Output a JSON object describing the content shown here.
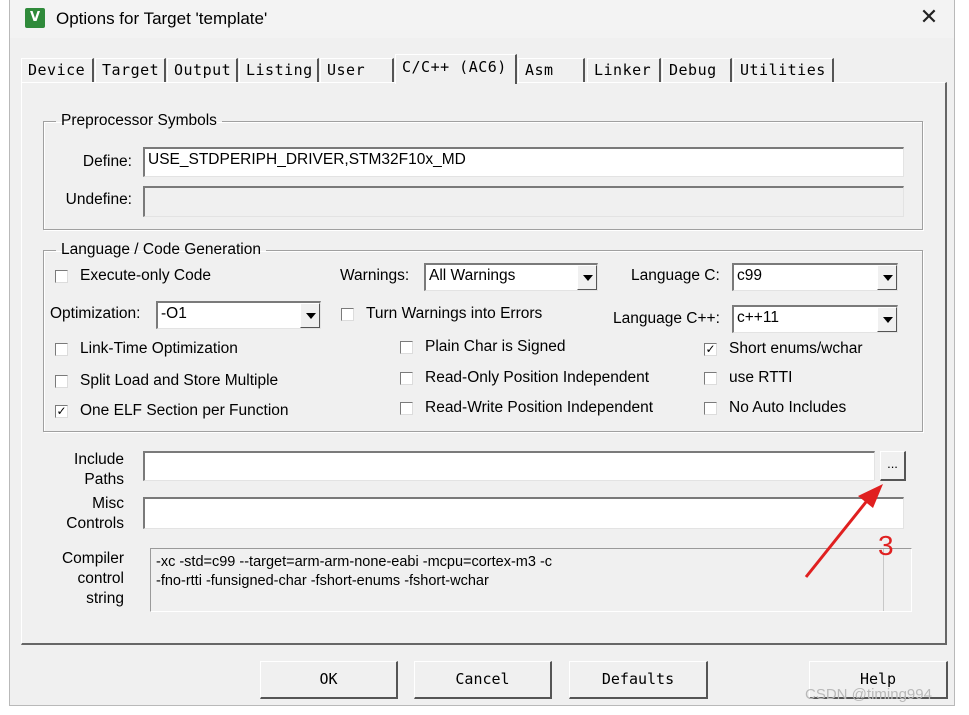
{
  "window": {
    "title": "Options for Target 'template'",
    "close_glyph": "✕"
  },
  "tabs": [
    {
      "label": "Device"
    },
    {
      "label": "Target"
    },
    {
      "label": "Output"
    },
    {
      "label": "Listing"
    },
    {
      "label": "User"
    },
    {
      "label": "C/C++ (AC6)",
      "active": true
    },
    {
      "label": "Asm"
    },
    {
      "label": "Linker"
    },
    {
      "label": "Debug"
    },
    {
      "label": "Utilities"
    }
  ],
  "preprocessor": {
    "title": "Preprocessor Symbols",
    "define_label": "Define:",
    "define_value": "USE_STDPERIPH_DRIVER,STM32F10x_MD",
    "undefine_label": "Undefine:",
    "undefine_value": ""
  },
  "language": {
    "title": "Language / Code Generation",
    "execute_only": {
      "label": "Execute-only Code",
      "checked": false
    },
    "warnings_label": "Warnings:",
    "warnings_value": "All Warnings",
    "language_c_label": "Language C:",
    "language_c_value": "c99",
    "optimization_label": "Optimization:",
    "optimization_value": "-O1",
    "warnings_errors": {
      "label": "Turn Warnings into Errors",
      "checked": false
    },
    "language_cpp_label": "Language C++:",
    "language_cpp_value": "c++11",
    "link_time": {
      "label": "Link-Time Optimization",
      "checked": false
    },
    "plain_char": {
      "label": "Plain Char is Signed",
      "checked": false
    },
    "short_enums": {
      "label": "Short enums/wchar",
      "checked": true
    },
    "split_load": {
      "label": "Split Load and Store Multiple",
      "checked": false
    },
    "ropi": {
      "label": "Read-Only Position Independent",
      "checked": false
    },
    "rtti": {
      "label": "use RTTI",
      "checked": false
    },
    "one_elf": {
      "label": "One ELF Section per Function",
      "checked": true
    },
    "rwpi": {
      "label": "Read-Write Position Independent",
      "checked": false
    },
    "no_auto_includes": {
      "label": "No Auto Includes",
      "checked": false
    },
    "check_mark": "✓"
  },
  "paths": {
    "include_label_1": "Include",
    "include_label_2": "Paths",
    "include_value": "",
    "browse_label": "...",
    "misc_label_1": "Misc",
    "misc_label_2": "Controls",
    "misc_value": "",
    "compiler_label_1": "Compiler",
    "compiler_label_2": "control",
    "compiler_label_3": "string",
    "compiler_line_1": "-xc -std=c99 --target=arm-arm-none-eabi -mcpu=cortex-m3 -c",
    "compiler_line_2": "-fno-rtti -funsigned-char -fshort-enums -fshort-wchar"
  },
  "buttons": {
    "ok": "OK",
    "cancel": "Cancel",
    "defaults": "Defaults",
    "help": "Help"
  },
  "annotation": {
    "number": "3",
    "color": "#e02020"
  },
  "watermark": "CSDN @timing994"
}
